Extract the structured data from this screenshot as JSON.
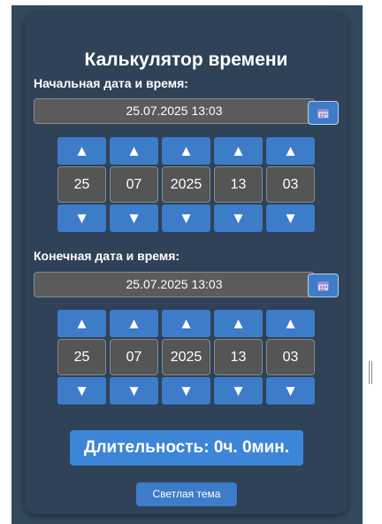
{
  "app": {
    "title": "Калькулятор времени"
  },
  "start": {
    "label": "Начальная дата и время:",
    "datetime": "25.07.2025 13:03",
    "fields": {
      "day": "25",
      "month": "07",
      "year": "2025",
      "hour": "13",
      "minute": "03"
    }
  },
  "end": {
    "label": "Конечная дата и время:",
    "datetime": "25.07.2025 13:03",
    "fields": {
      "day": "25",
      "month": "07",
      "year": "2025",
      "hour": "13",
      "minute": "03"
    }
  },
  "arrows": {
    "up": "▲",
    "down": "▼"
  },
  "duration": "Длительность: 0ч. 0мин.",
  "theme_button": "Светлая тема",
  "icons": {
    "calendar": "calendar-icon"
  },
  "colors": {
    "background": "#2f4257",
    "accent": "#3d7cc9",
    "field": "#555555"
  }
}
